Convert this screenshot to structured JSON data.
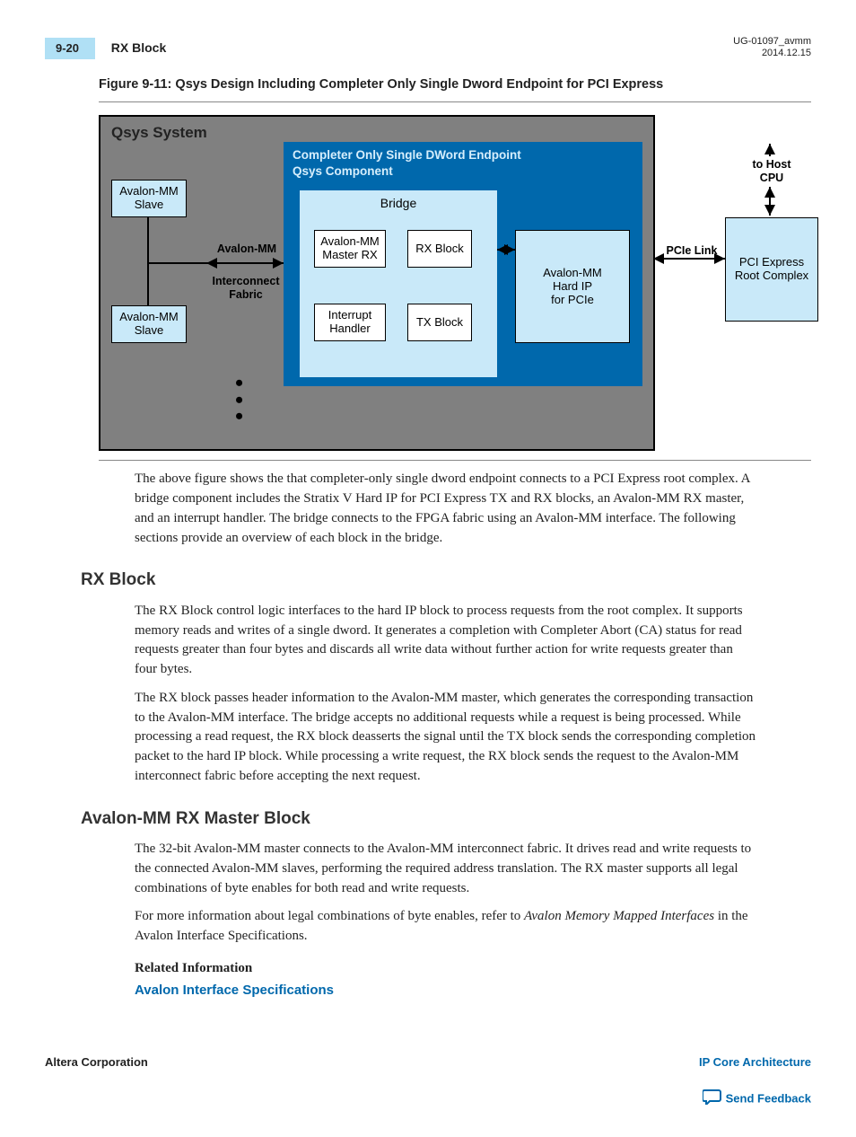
{
  "header": {
    "page_num": "9-20",
    "section": "RX Block",
    "doc_id": "UG-01097_avmm",
    "date": "2014.12.15"
  },
  "figure": {
    "caption": "Figure 9-11: Qsys Design Including Completer Only Single Dword Endpoint for PCI Express",
    "qsys_title": "Qsys System",
    "comp_title_l1": "Completer Only Single DWord Endpoint",
    "comp_title_l2": "Qsys Component",
    "bridge": "Bridge",
    "slave": "Avalon-MM\nSlave",
    "master_rx": "Avalon-MM\nMaster RX",
    "rx_block": "RX Block",
    "int_handler": "Interrupt\nHandler",
    "tx_block": "TX Block",
    "hard_ip": "Avalon-MM\nHard IP\nfor PCIe",
    "root_complex": "PCI Express\nRoot Complex",
    "avmm_label": "Avalon-MM",
    "interconnect": "Interconnect\nFabric",
    "pcie_link": "PCIe Link",
    "to_host": "to Host\nCPU"
  },
  "body": {
    "p1": "The above figure shows the that completer‑only single dword endpoint connects to a PCI Express root complex. A bridge component includes the Stratix V Hard IP for PCI Express TX and RX blocks, an Avalon‑MM RX master, and an interrupt handler. The bridge connects to the FPGA fabric using an Avalon‑MM interface. The following sections provide an overview of each block in the bridge.",
    "h_rx": "RX Block",
    "p2": "The RX Block control logic interfaces to the hard IP block to process requests from the root complex. It supports memory reads and writes of a single dword. It generates a completion with Completer Abort (CA) status for read requests greater than four bytes and discards all write data without further action for write requests greater than four bytes.",
    "p3": "The RX block passes header information to the Avalon‑MM master, which generates the corresponding transaction to the Avalon-MM interface. The bridge accepts no additional requests while a request is being processed. While processing a read request, the RX block deasserts the              signal until the TX block sends the corresponding completion packet to the hard IP block. While processing a write request, the RX block sends the request to the Avalon-MM interconnect fabric before accepting the next request.",
    "h_avmm": "Avalon-MM RX Master Block",
    "p4": "The 32-bit Avalon-MM master connects to the Avalon-MM interconnect fabric. It drives read and write requests to the connected Avalon-MM slaves, performing the required address translation. The RX master supports all legal combinations of byte enables for both read and write requests.",
    "p5a": "For more information about legal combinations of byte enables, refer to ",
    "p5i": "Avalon Memory Mapped Interfaces",
    "p5b": " in the Avalon Interface Specifications.",
    "related": "Related Information",
    "link1": "Avalon Interface Specifications"
  },
  "footer": {
    "corp": "Altera Corporation",
    "arch": "IP Core Architecture",
    "feedback": "Send Feedback"
  }
}
